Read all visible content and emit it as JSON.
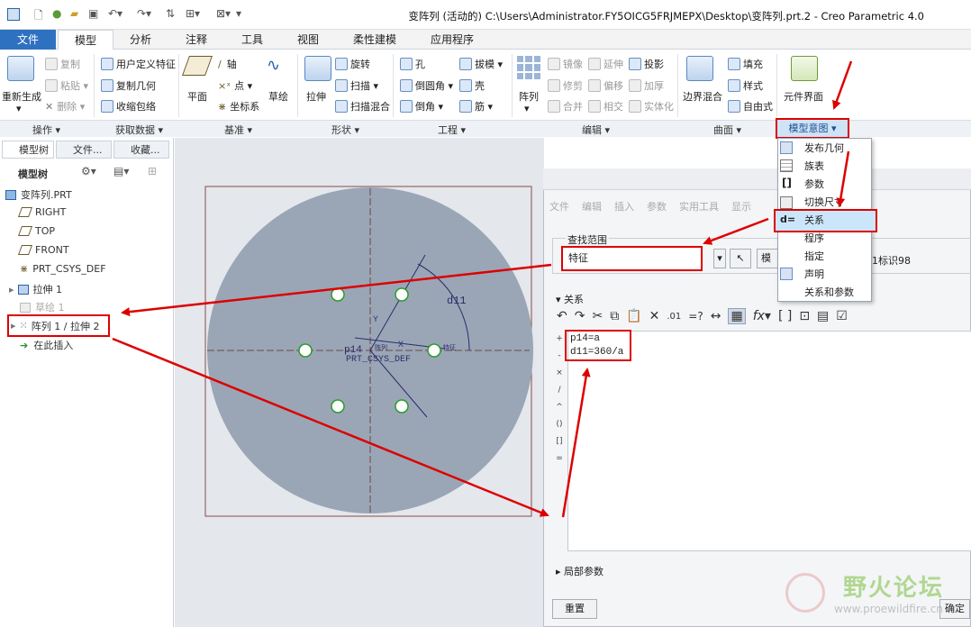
{
  "window": {
    "title": "变阵列 (活动的) C:\\Users\\Administrator.FY5OICG5FRJMEPX\\Desktop\\变阵列.prt.2 - Creo Parametric 4.0"
  },
  "tabs": [
    "文件",
    "模型",
    "分析",
    "注释",
    "工具",
    "视图",
    "柔性建模",
    "应用程序"
  ],
  "ribbon": {
    "groups": [
      "操作 ▾",
      "获取数据 ▾",
      "基准 ▾",
      "形状 ▾",
      "工程 ▾",
      "编辑 ▾",
      "曲面 ▾",
      "模型意图 ▾"
    ],
    "ops": {
      "regen": "重新生成",
      "copy": "复制",
      "paste": "粘贴 ▾",
      "delete": "删除 ▾"
    },
    "getdata": {
      "udf": "用户定义特征",
      "copygeom": "复制几何",
      "shrink": "收缩包络"
    },
    "datum": {
      "plane": "平面",
      "axis": "轴",
      "point": "点 ▾",
      "csys": "坐标系",
      "sketch": "草绘"
    },
    "shape": {
      "extrude": "拉伸",
      "revolve": "旋转",
      "sweep": "扫描 ▾",
      "swept_blend": "扫描混合"
    },
    "eng": {
      "hole": "孔",
      "round": "倒圆角 ▾",
      "chamfer": "倒角 ▾",
      "draft": "拔模 ▾",
      "shell": "壳",
      "rib": "筋 ▾"
    },
    "edit": {
      "pattern": "阵列",
      "mirror": "镜像",
      "extend": "延伸",
      "project": "投影",
      "trim": "修剪",
      "offset": "偏移",
      "thicken": "加厚",
      "merge": "合并",
      "intersect": "相交",
      "solidify": "实体化"
    },
    "surface": {
      "boundary": "边界混合",
      "fill": "填充",
      "style": "样式",
      "freestyle": "自由式"
    },
    "intent": {
      "component_interface": "元件界面"
    }
  },
  "dropdown_items": [
    "发布几何",
    "族表",
    "参数",
    "切换尺寸",
    "关系",
    "程序",
    "指定",
    "声明",
    "关系和参数"
  ],
  "panel": {
    "tabs": [
      "模型树",
      "文件...",
      "收藏..."
    ],
    "toolbar_label": "模型树",
    "tree": [
      "变阵列.PRT",
      "RIGHT",
      "TOP",
      "FRONT",
      "PRT_CSYS_DEF",
      "拉伸 1",
      "草绘 1",
      "阵列 1 / 拉伸 2",
      "在此插入"
    ]
  },
  "graphics": {
    "dim_label": "d11",
    "p_label": "p14",
    "csys_label": "PRT_CSYS_DEF",
    "y_label": "Y",
    "x_label": "X",
    "tag1": "阵列",
    "tag2": "特征"
  },
  "dialog": {
    "menu": [
      "文件",
      "编辑",
      "插入",
      "参数",
      "实用工具",
      "显示"
    ],
    "search_scope_label": "查找范围",
    "scope_value": "特征",
    "model_btn": "模型",
    "id_text": "1标识98",
    "relations_label": "关系",
    "relations": [
      "p14=a",
      "d11=360/a"
    ],
    "gutter": [
      "+",
      "-",
      "×",
      "/",
      "^",
      "()",
      "[]",
      "="
    ],
    "local_params": "局部参数",
    "reset": "重置",
    "ok": "确定"
  },
  "watermark": {
    "name": "野火论坛",
    "url": "www.proewildfire.cn"
  }
}
